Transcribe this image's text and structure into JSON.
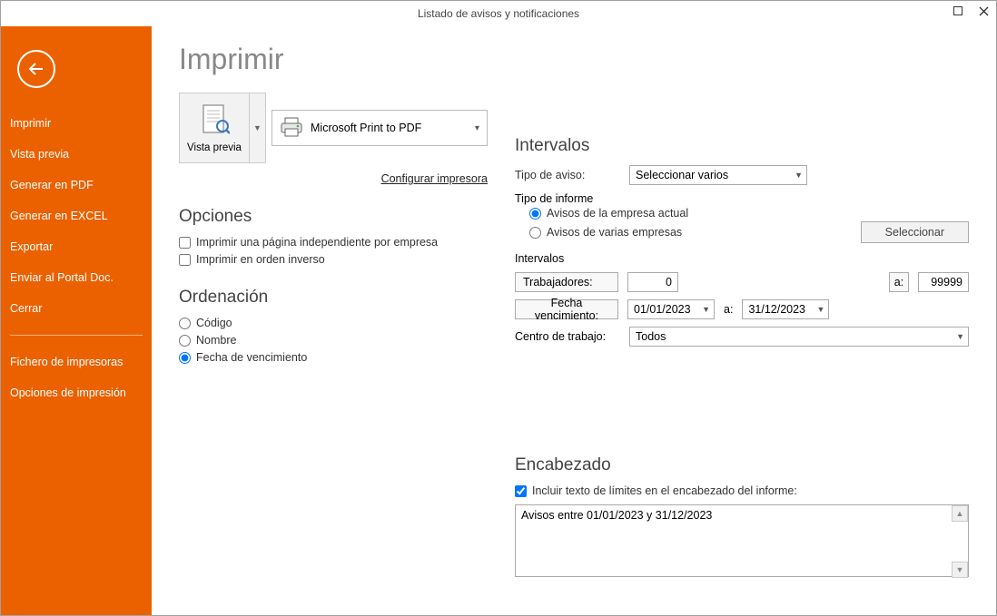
{
  "window": {
    "title": "Listado de avisos y notificaciones"
  },
  "sidebar": {
    "items": [
      "Imprimir",
      "Vista previa",
      "Generar en PDF",
      "Generar en EXCEL",
      "Exportar",
      "Enviar al Portal Doc.",
      "Cerrar"
    ],
    "footer_items": [
      "Fichero de impresoras",
      "Opciones de impresión"
    ]
  },
  "page_title": "Imprimir",
  "preview_button": "Vista previa",
  "printer_selected": "Microsoft Print to PDF",
  "configure_printer": "Configurar impresora",
  "options": {
    "heading": "Opciones",
    "independent_page": "Imprimir una página independiente por empresa",
    "reverse_order": "Imprimir en orden inverso"
  },
  "ordering": {
    "heading": "Ordenación",
    "code": "Código",
    "name": "Nombre",
    "due_date": "Fecha de vencimiento"
  },
  "intervals": {
    "heading": "Intervalos",
    "tipo_aviso_label": "Tipo de aviso:",
    "tipo_aviso_value": "Seleccionar varios",
    "tipo_informe_label": "Tipo de informe",
    "radio_current": "Avisos de la empresa actual",
    "radio_multi": "Avisos de varias empresas",
    "select_button": "Seleccionar",
    "sub_heading": "Intervalos",
    "trabajadores_label": "Trabajadores:",
    "trabajadores_from": "0",
    "to_label": "a:",
    "trabajadores_to": "99999",
    "fecha_venc_label": "Fecha vencimiento:",
    "fecha_from": "01/01/2023",
    "fecha_to": "31/12/2023",
    "centro_label": "Centro de trabajo:",
    "centro_value": "Todos"
  },
  "encabezado": {
    "heading": "Encabezado",
    "check_label": "Incluir texto de límites en el encabezado del informe:",
    "text": "Avisos entre 01/01/2023 y 31/12/2023"
  }
}
